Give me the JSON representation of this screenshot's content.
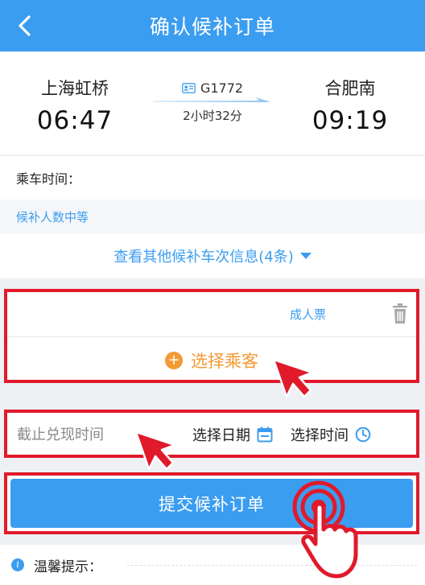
{
  "header": {
    "title": "确认候补订单",
    "back_icon": "chevron-left-icon"
  },
  "train": {
    "from_station": "上海虹桥",
    "from_time": "06:47",
    "to_station": "合肥南",
    "to_time": "09:19",
    "train_no": "G1772",
    "duration": "2小时32分"
  },
  "ride": {
    "label": "乘车时间："
  },
  "waitlist": {
    "status": "候补人数中等"
  },
  "others": {
    "label": "查看其他候补车次信息(4条)"
  },
  "passenger": {
    "ticket_type": "成人票",
    "choose_label": "选择乘客"
  },
  "deadline": {
    "label": "截止兑现时间",
    "date_label": "选择日期",
    "time_label": "选择时间"
  },
  "submit": {
    "label": "提交候补订单"
  },
  "tips": {
    "label": "温馨提示："
  },
  "colors": {
    "brand": "#3b9df0",
    "accent": "#f39a34",
    "highlight": "#e01a2b"
  }
}
